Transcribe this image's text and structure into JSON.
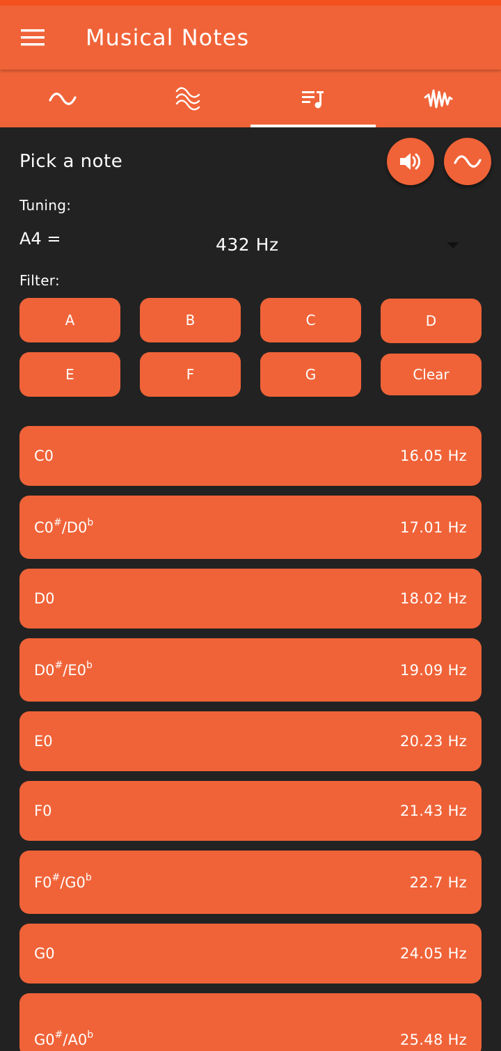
{
  "app": {
    "title": "Musical Notes"
  },
  "header": {
    "menu_icon": "hamburger-menu-icon"
  },
  "tabs": [
    {
      "icon": "sine-wave-icon",
      "active": false
    },
    {
      "icon": "multi-wave-icon",
      "active": false
    },
    {
      "icon": "note-list-icon",
      "active": true
    },
    {
      "icon": "noise-wave-icon",
      "active": false
    }
  ],
  "main": {
    "heading": "Pick a note",
    "tuning_label": "Tuning:",
    "a4_label": "A4 =",
    "tuning_value": "432 Hz",
    "filter_label": "Filter:",
    "play_icon": "speaker-icon",
    "wave_icon": "sine-wave-icon"
  },
  "filters": [
    "A",
    "B",
    "C",
    "D",
    "E",
    "F",
    "G",
    "Clear"
  ],
  "notes": [
    {
      "name": "C0",
      "freq": "16.05 Hz"
    },
    {
      "name": "C0#/D0b",
      "base1": "C0",
      "sharp": "#",
      "base2": "/D0",
      "flat": "b",
      "freq": "17.01 Hz"
    },
    {
      "name": "D0",
      "freq": "18.02 Hz"
    },
    {
      "name": "D0#/E0b",
      "base1": "D0",
      "sharp": "#",
      "base2": "/E0",
      "flat": "b",
      "freq": "19.09 Hz"
    },
    {
      "name": "E0",
      "freq": "20.23 Hz"
    },
    {
      "name": "F0",
      "freq": "21.43 Hz"
    },
    {
      "name": "F0#/G0b",
      "base1": "F0",
      "sharp": "#",
      "base2": "/G0",
      "flat": "b",
      "freq": "22.7 Hz"
    },
    {
      "name": "G0",
      "freq": "24.05 Hz"
    },
    {
      "name": "G0#/A0b",
      "base1": "G0",
      "sharp": "#",
      "base2": "/A0",
      "flat": "b",
      "freq": "25.48 Hz"
    }
  ],
  "colors": {
    "accent": "#f06338",
    "background": "#222222",
    "text": "#ffffff"
  }
}
